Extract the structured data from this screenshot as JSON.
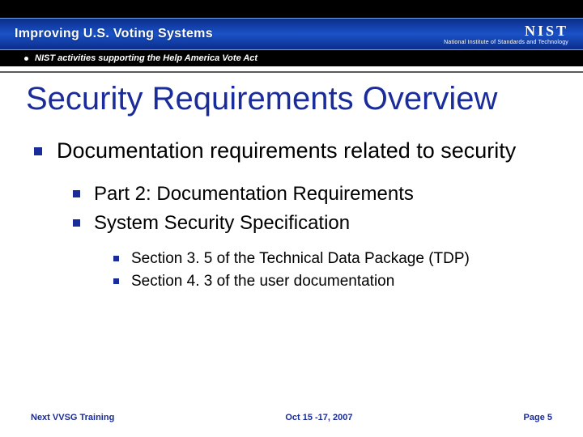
{
  "header": {
    "main": "Improving U.S. Voting Systems",
    "sub": "NIST activities supporting the Help America Vote Act",
    "org_logo": "NIST",
    "org_sub": "National Institute of Standards and Technology"
  },
  "title": "Security Requirements Overview",
  "bullets": {
    "lvl1_0": "Documentation requirements related to security",
    "lvl2_0": "Part 2: Documentation Requirements",
    "lvl2_1": "System Security Specification",
    "lvl3_0": "Section 3. 5 of the Technical Data Package (TDP)",
    "lvl3_1": "Section 4. 3 of the user documentation"
  },
  "footer": {
    "left": "Next VVSG Training",
    "center": "Oct 15 -17, 2007",
    "right": "Page 5"
  }
}
